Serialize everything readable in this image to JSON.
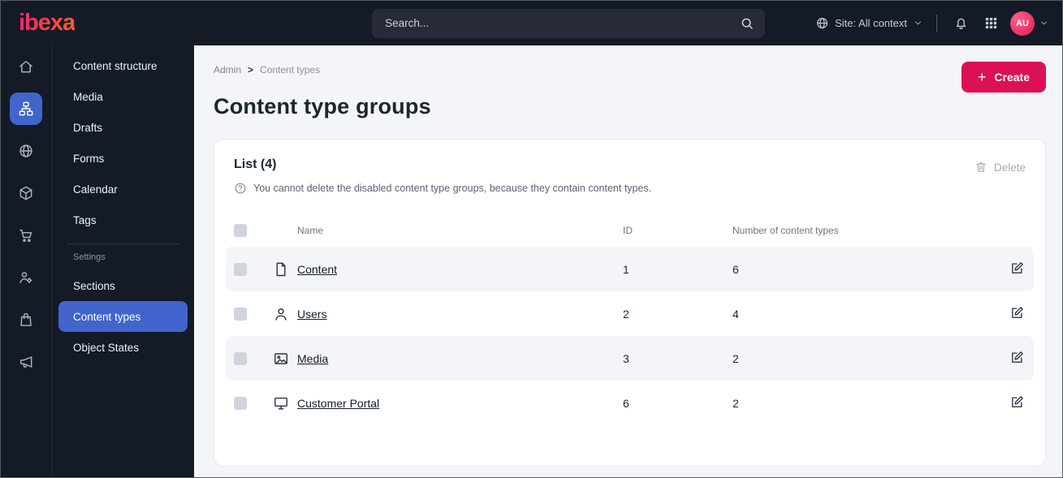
{
  "topbar": {
    "logo_text": "ibexa",
    "search_placeholder": "Search...",
    "site_context_label": "Site: All context",
    "avatar_initials": "AU"
  },
  "rail": {
    "icons": [
      "home-icon",
      "content-structure-icon",
      "site-globe-icon",
      "product-catalog-icon",
      "cart-icon",
      "customers-icon",
      "orders-icon",
      "campaign-icon"
    ],
    "active_index": 1
  },
  "sidebar": {
    "items": [
      {
        "label": "Content structure"
      },
      {
        "label": "Media"
      },
      {
        "label": "Drafts"
      },
      {
        "label": "Forms"
      },
      {
        "label": "Calendar"
      },
      {
        "label": "Tags"
      }
    ],
    "settings_label": "Settings",
    "settings_items": [
      {
        "label": "Sections"
      },
      {
        "label": "Content types",
        "active": true
      },
      {
        "label": "Object States"
      }
    ]
  },
  "main": {
    "breadcrumb": {
      "items": [
        "Admin",
        "Content types"
      ],
      "separator": ">"
    },
    "create_button": {
      "label": "Create"
    },
    "title": "Content type groups",
    "list": {
      "title": "List (4)",
      "help_text": "You cannot delete the disabled content type groups, because they contain content types.",
      "delete_label": "Delete",
      "columns": {
        "name": "Name",
        "id": "ID",
        "count": "Number of content types"
      },
      "rows": [
        {
          "name": "Content",
          "id": "1",
          "count": "6",
          "icon": "content-file-icon"
        },
        {
          "name": "Users",
          "id": "2",
          "count": "4",
          "icon": "user-icon"
        },
        {
          "name": "Media",
          "id": "3",
          "count": "2",
          "icon": "image-icon"
        },
        {
          "name": "Customer Portal",
          "id": "6",
          "count": "2",
          "icon": "monitor-icon"
        }
      ]
    }
  },
  "colors": {
    "dark_bg": "#141a26",
    "accent_blue": "#4164cd",
    "brand_pink": "#dc1054",
    "stripe": "#f4f5f8"
  }
}
